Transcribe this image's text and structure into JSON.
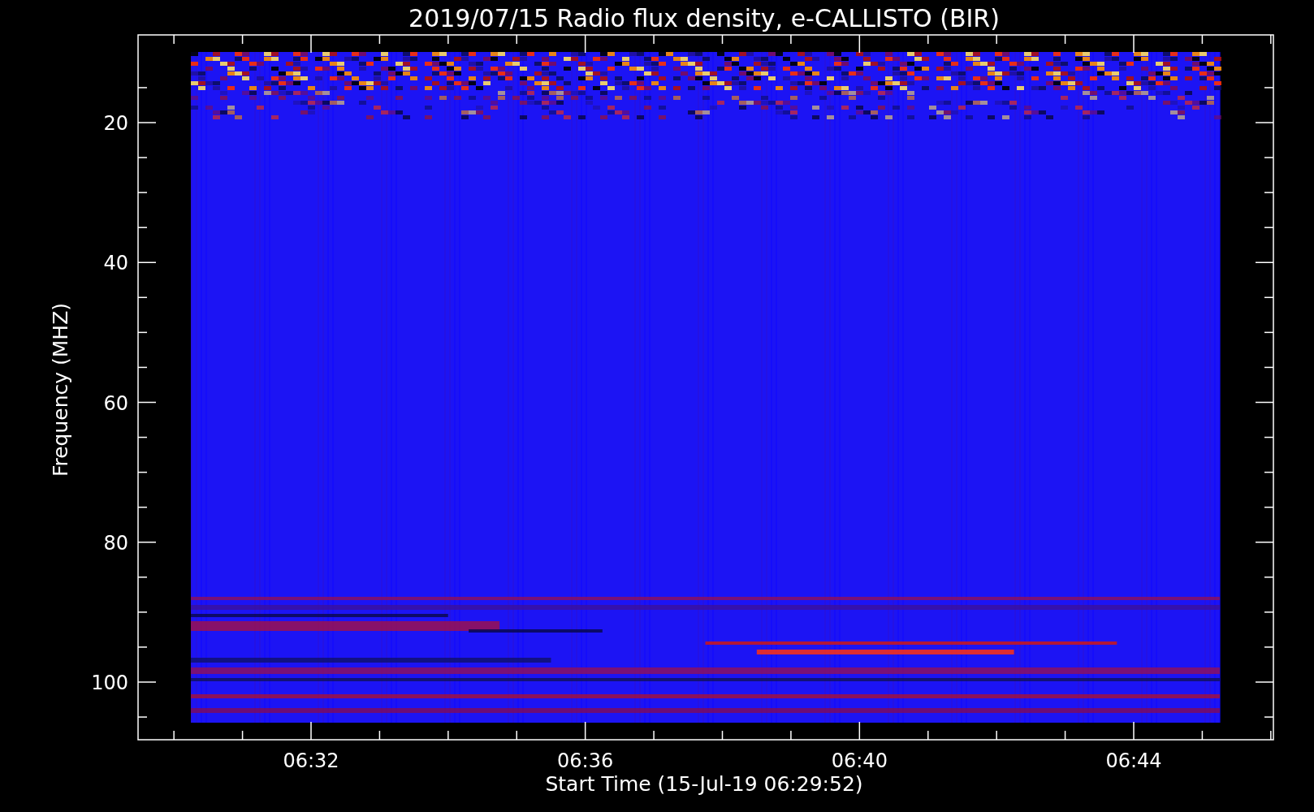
{
  "title": "2019/07/15  Radio flux density, e-CALLISTO (BIR)",
  "y_axis": {
    "label": "Frequency (MHZ)",
    "tick_labels": [
      "20",
      "40",
      "60",
      "80",
      "100"
    ]
  },
  "x_axis": {
    "label": "Start Time (15-Jul-19 06:29:52)",
    "tick_labels": [
      "06:32",
      "06:36",
      "06:40",
      "06:44"
    ]
  }
}
